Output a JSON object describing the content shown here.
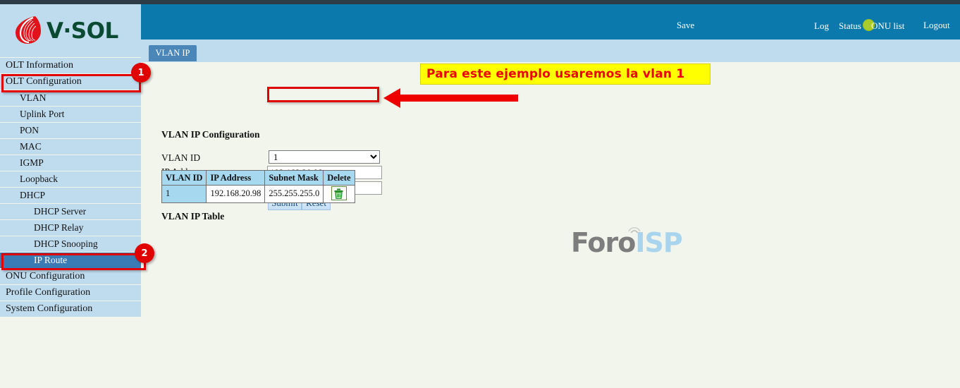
{
  "brand": {
    "logo_text": "V·SOL",
    "logo_mark": "vsol-flame-logo"
  },
  "header": {
    "save_label": "Save",
    "status_indicator": "green-status-dot",
    "status_color": "#aacb2c",
    "links": [
      {
        "label": "Log",
        "name": "log"
      },
      {
        "label": "Status",
        "name": "status"
      },
      {
        "label": "ONU list",
        "name": "onu-list"
      },
      {
        "label": "Logout",
        "name": "logout"
      }
    ]
  },
  "tab": {
    "label": "VLAN IP"
  },
  "sidebar": {
    "items": [
      {
        "label": "OLT Information",
        "level": 0,
        "active": false
      },
      {
        "label": "OLT Configuration",
        "level": 0,
        "active": false
      },
      {
        "label": "VLAN",
        "level": 1,
        "active": false
      },
      {
        "label": "Uplink Port",
        "level": 1,
        "active": false
      },
      {
        "label": "PON",
        "level": 1,
        "active": false
      },
      {
        "label": "MAC",
        "level": 1,
        "active": false
      },
      {
        "label": "IGMP",
        "level": 1,
        "active": false
      },
      {
        "label": "Loopback",
        "level": 1,
        "active": false
      },
      {
        "label": "DHCP",
        "level": 1,
        "active": false
      },
      {
        "label": "DHCP Server",
        "level": 2,
        "active": false
      },
      {
        "label": "DHCP Relay",
        "level": 2,
        "active": false
      },
      {
        "label": "DHCP Snooping",
        "level": 2,
        "active": false
      },
      {
        "label": "IP Route",
        "level": 2,
        "active": true
      },
      {
        "label": "ONU Configuration",
        "level": 0,
        "active": false
      },
      {
        "label": "Profile Configuration",
        "level": 0,
        "active": false
      },
      {
        "label": "System Configuration",
        "level": 0,
        "active": false
      }
    ]
  },
  "main": {
    "config_title": "VLAN IP Configuration",
    "table_title": "VLAN IP Table",
    "form": {
      "vlan_id_label": "VLAN ID",
      "vlan_id_value": "1",
      "vlan_id_options": [
        "1"
      ],
      "ip_address_label": "IP Address",
      "ip_address_value": "192.168.20.98",
      "subnet_mask_label": "Subnet Mask",
      "subnet_mask_value": "255.255.255.0",
      "submit_label": "Submit",
      "reset_label": "Reset"
    },
    "table": {
      "headers": [
        "VLAN ID",
        "IP Address",
        "Subnet Mask",
        "Delete"
      ],
      "rows": [
        {
          "vlan_id": "1",
          "ip_address": "192.168.20.98",
          "subnet_mask": "255.255.255.0",
          "delete_icon": "trash-icon"
        }
      ]
    }
  },
  "annotations": {
    "note_text": "Para este ejemplo usaremos la vlan 1",
    "note_bg": "#ffff00",
    "note_fg": "#ee0000",
    "badge_1": "1",
    "badge_2": "2",
    "arrow": "red-left-arrow"
  },
  "watermark": {
    "part1": "Foro",
    "part2": "ISP"
  }
}
